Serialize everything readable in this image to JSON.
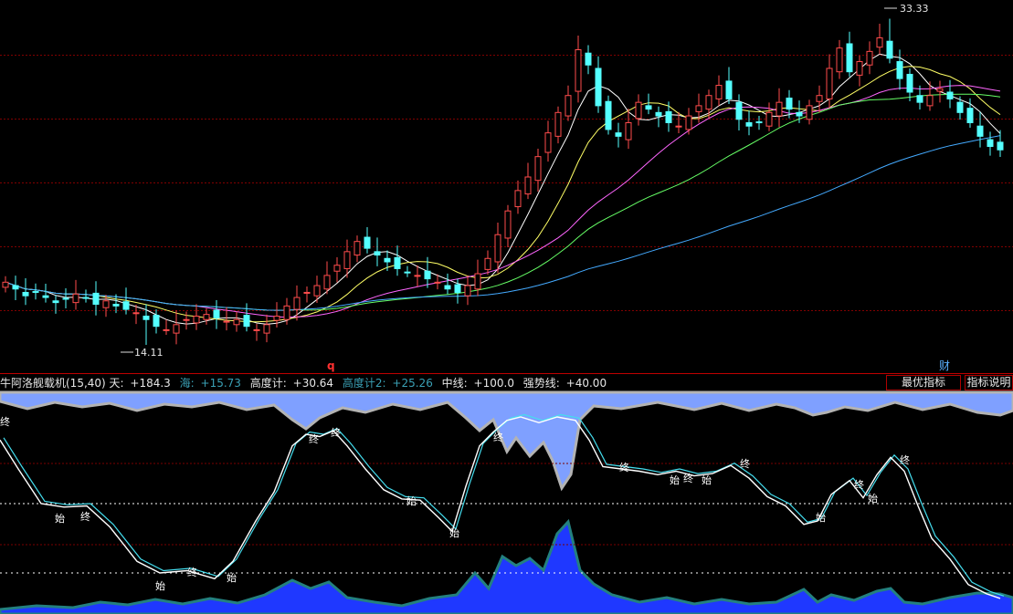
{
  "chart_data": [
    {
      "type": "candlestick",
      "panel": "price",
      "annotations": {
        "high_value": "33.33",
        "low_value": "14.11",
        "marker_q": "q",
        "marker_cai": "财"
      },
      "grid": "dashed-red",
      "colors": {
        "up": "#ff4c4c",
        "down": "#54ffff",
        "ma5": "#ffffff",
        "ma10": "#ffff66",
        "ma20": "#ff66ff",
        "ma30": "#66ff66",
        "ma60": "#44aaff"
      },
      "candles_close": [
        17.8,
        17.4,
        17.0,
        17.2,
        16.9,
        16.6,
        16.8,
        17.1,
        16.9,
        16.5,
        16.7,
        16.4,
        16.2,
        16.0,
        15.6,
        15.2,
        15.0,
        15.3,
        15.6,
        15.8,
        15.9,
        15.7,
        15.5,
        15.6,
        15.2,
        15.0,
        15.3,
        15.8,
        16.4,
        16.9,
        17.2,
        17.6,
        18.2,
        18.8,
        19.6,
        20.2,
        19.8,
        19.4,
        19.0,
        18.6,
        18.4,
        18.2,
        18.0,
        17.8,
        17.4,
        17.2,
        17.6,
        18.3,
        19.2,
        20.6,
        22.0,
        23.2,
        24.0,
        25.2,
        26.6,
        27.8,
        28.8,
        31.5,
        30.6,
        28.2,
        26.8,
        26.4,
        27.2,
        28.4,
        28.0,
        27.6,
        27.2,
        27.0,
        27.6,
        28.2,
        28.8,
        29.4,
        28.6,
        27.4,
        27.0,
        27.2,
        27.8,
        28.4,
        28.0,
        27.6,
        28.2,
        28.8,
        30.4,
        31.6,
        30.2,
        30.8,
        31.4,
        32.2,
        31.0,
        29.8,
        29.0,
        28.4,
        28.8,
        29.2,
        28.6,
        27.8,
        27.2,
        26.4,
        25.8,
        25.6
      ]
    },
    {
      "type": "line",
      "panel": "indicator",
      "header": {
        "name": "牛阿洛舰载机(15,40) 天:",
        "tian": "+184.3",
        "hai_label": "海:",
        "hai": "+15.73",
        "gaodu_label": "高度计:",
        "gaodu": "+30.64",
        "gaodu2_label": "高度计2:",
        "gaodu2": "+25.26",
        "zhongxian_label": "中线:",
        "zhongxian": "+100.0",
        "qiangshi_label": "强势线:",
        "qiangshi": "+40.00"
      },
      "buttons": {
        "best": "最优指标",
        "explain": "指标说明"
      },
      "labels": {
        "shi": "始",
        "zhong": "终"
      },
      "levels": [
        100,
        40
      ],
      "colors": {
        "sky": "#7fa0ff",
        "sea": "#1f38ff",
        "edge": "#b3b3b3",
        "sea_edge": "#23807f",
        "kd": "#ffffff",
        "kd2": "#44ddee"
      }
    }
  ]
}
